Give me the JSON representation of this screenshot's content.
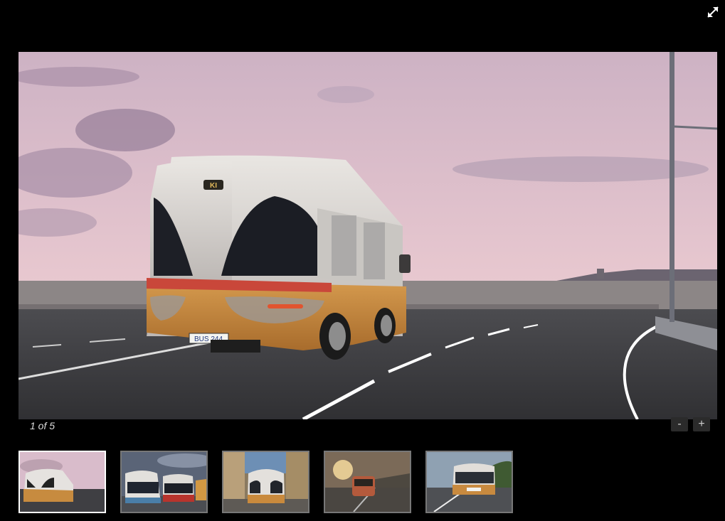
{
  "gallery": {
    "counter": "1 of 5",
    "zoom_out_label": "-",
    "zoom_in_label": "+",
    "fullscreen_icon": "expand-arrows-icon",
    "main_bus": {
      "badge": "KI",
      "plate": "BUS 244"
    },
    "thumbnails": [
      {
        "scene": "sunset-coastal-road-rear",
        "active": true
      },
      {
        "scene": "depot-three-buses",
        "active": false
      },
      {
        "scene": "narrow-street-front",
        "active": false
      },
      {
        "scene": "sunset-road-distance",
        "active": false
      },
      {
        "scene": "road-front-green",
        "active": false
      }
    ]
  }
}
